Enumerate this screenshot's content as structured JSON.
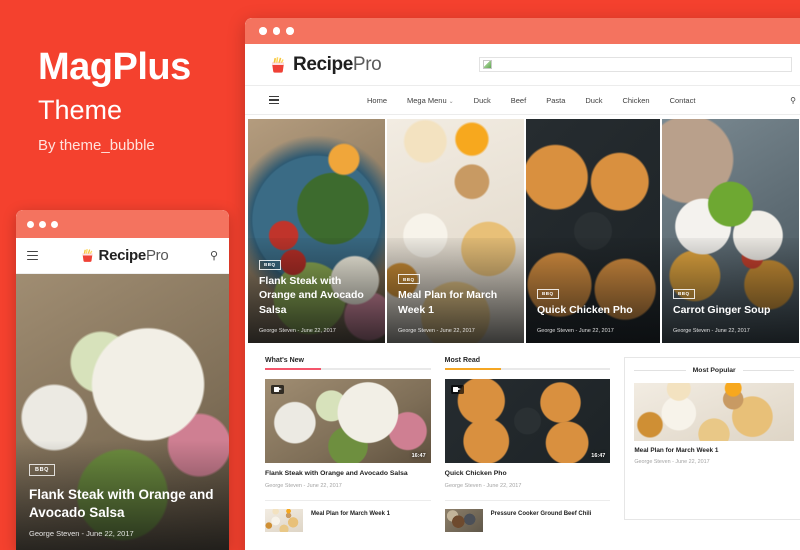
{
  "promo": {
    "title": "MagPlus",
    "subtitle": "Theme",
    "author": "By theme_bubble",
    "brand_color": "#f4412e"
  },
  "brand": {
    "name_bold": "Recipe",
    "name_light": "Pro",
    "logo_icon": "french-fries-icon"
  },
  "mobile": {
    "menu_icon": "hamburger-icon",
    "search_icon": "search-icon",
    "hero": {
      "badge": "BBQ",
      "title": "Flank Steak with Orange and Avocado Salsa",
      "meta": "George Steven - June 22, 2017"
    }
  },
  "desktop": {
    "ad_banner": {
      "icon": "broken-image-icon"
    },
    "nav": {
      "menu_icon": "hamburger-icon",
      "search_icon": "search-icon",
      "items": [
        {
          "label": "Home",
          "has_caret": false
        },
        {
          "label": "Mega Menu",
          "has_caret": true
        },
        {
          "label": "Duck",
          "has_caret": false
        },
        {
          "label": "Beef",
          "has_caret": false
        },
        {
          "label": "Pasta",
          "has_caret": false
        },
        {
          "label": "Duck",
          "has_caret": false
        },
        {
          "label": "Chicken",
          "has_caret": false
        },
        {
          "label": "Contact",
          "has_caret": false
        }
      ]
    },
    "hero_cards": [
      {
        "badge": "BBQ",
        "title": "Flank Steak with Orange and Avocado Salsa",
        "meta": "George Steven - June 22, 2017",
        "photo": "ph-salad"
      },
      {
        "badge": "BBQ",
        "title": "Meal Plan for March Week 1",
        "meta": "George Steven - June 22, 2017",
        "photo": "ph-breakfast"
      },
      {
        "badge": "BBQ",
        "title": "Quick Chicken Pho",
        "meta": "George Steven - June 22, 2017",
        "photo": "ph-pizza"
      },
      {
        "badge": "BBQ",
        "title": "Carrot Ginger Soup",
        "meta": "George Steven - June 22, 2017",
        "photo": "ph-nachos"
      }
    ],
    "columns": [
      {
        "heading": "What's New",
        "accent": "#f4556b",
        "feature": {
          "title": "Flank Steak with Orange and Avocado Salsa",
          "meta": "George Steven - June 22, 2017",
          "duration": "16:47",
          "video_icon": "video-camera-icon",
          "photo": "ph-plate"
        },
        "mini": {
          "title": "Meal Plan for March Week 1",
          "photo": "ph-breakfast"
        }
      },
      {
        "heading": "Most Read",
        "accent": "#f5a623",
        "feature": {
          "title": "Quick Chicken Pho",
          "meta": "George Steven - June 22, 2017",
          "duration": "16:47",
          "video_icon": "video-camera-icon",
          "photo": "ph-pizza"
        },
        "mini": {
          "title": "Pressure Cooker Ground Beef Chili",
          "photo": "ph-chili"
        }
      }
    ],
    "sidebar": {
      "heading": "Most Popular",
      "feature": {
        "title": "Meal Plan for March Week 1",
        "meta": "George Steven - June 22, 2017",
        "photo": "ph-breakfast"
      },
      "second": {
        "photo": "ph-pizza"
      }
    }
  }
}
